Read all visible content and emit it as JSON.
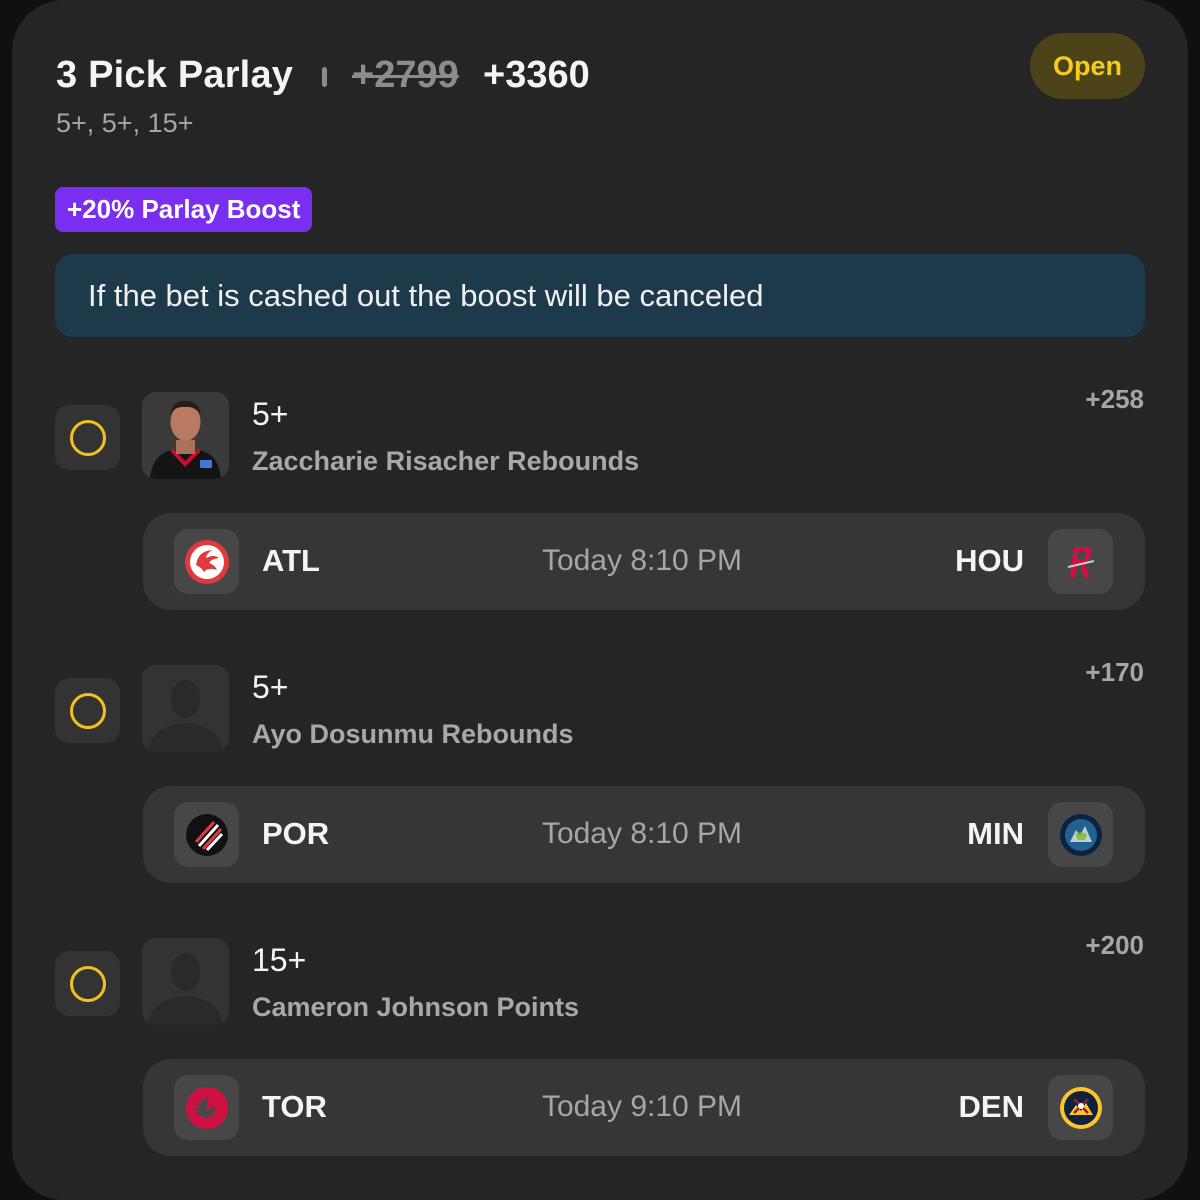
{
  "header": {
    "title": "3 Pick Parlay",
    "old_odds": "+2799",
    "new_odds": "+3360",
    "subtitle": "5+, 5+, 15+",
    "status": "Open"
  },
  "boost_label": "+20% Parlay Boost",
  "notice": "If the bet is cashed out the boost will be canceled",
  "colors": {
    "accent_yellow": "#f2c21b",
    "boost_purple": "#7a2ff0",
    "notice_blue": "#1d3a4b",
    "card_bg": "#252525"
  },
  "legs": [
    {
      "line": "5+",
      "market": "Zaccharie Risacher Rebounds",
      "odds": "+258",
      "avatar": "player-photo",
      "away": {
        "abbr": "ATL",
        "icon": "hawks-logo-icon"
      },
      "home": {
        "abbr": "HOU",
        "icon": "rockets-logo-icon"
      },
      "time": "Today 8:10 PM"
    },
    {
      "line": "5+",
      "market": "Ayo Dosunmu Rebounds",
      "odds": "+170",
      "avatar": "placeholder-silhouette",
      "away": {
        "abbr": "POR",
        "icon": "blazers-logo-icon"
      },
      "home": {
        "abbr": "MIN",
        "icon": "timberwolves-logo-icon"
      },
      "time": "Today 8:10 PM"
    },
    {
      "line": "15+",
      "market": "Cameron Johnson Points",
      "odds": "+200",
      "avatar": "placeholder-silhouette",
      "away": {
        "abbr": "TOR",
        "icon": "raptors-logo-icon"
      },
      "home": {
        "abbr": "DEN",
        "icon": "nuggets-logo-icon"
      },
      "time": "Today 9:10 PM"
    }
  ]
}
